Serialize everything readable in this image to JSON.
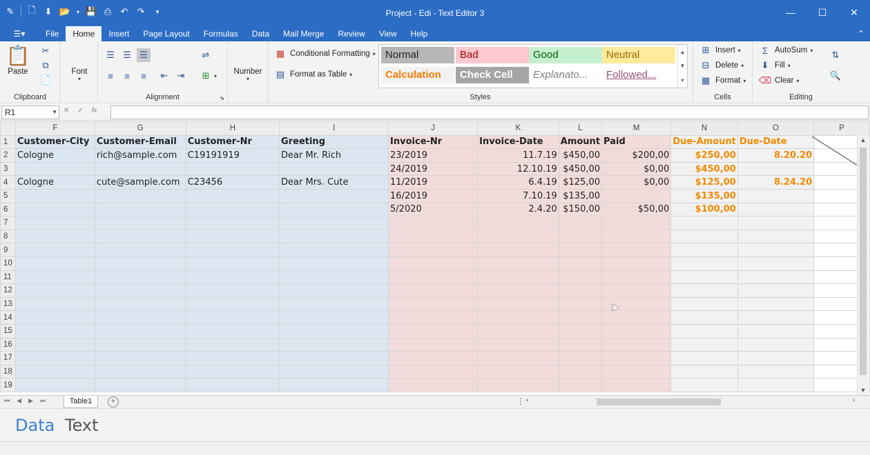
{
  "window": {
    "title": "Project - Edi - Text Editor 3"
  },
  "ribbon_tabs": [
    "File",
    "Home",
    "Insert",
    "Page Layout",
    "Formulas",
    "Data",
    "Mail Merge",
    "Review",
    "View",
    "Help"
  ],
  "ribbon": {
    "clipboard": {
      "paste": "Paste",
      "label": "Clipboard"
    },
    "font": {
      "button": "Font"
    },
    "alignment": {
      "label": "Alignment"
    },
    "number": {
      "button": "Number"
    },
    "conditional_formatting": "Conditional Formatting",
    "format_as_table": "Format as Table",
    "styles": {
      "label": "Styles",
      "items": [
        {
          "name": "Normal",
          "bg": "#b7b7b7",
          "fg": "#222222"
        },
        {
          "name": "Bad",
          "bg": "#ffc7ce",
          "fg": "#9c0006"
        },
        {
          "name": "Good",
          "bg": "#c6efce",
          "fg": "#006100"
        },
        {
          "name": "Neutral",
          "bg": "#ffeb9c",
          "fg": "#9c6500"
        },
        {
          "name": "Calculation",
          "bg": "#f2f2f2",
          "fg": "#fa7d00"
        },
        {
          "name": "Check Cell",
          "bg": "#a5a5a5",
          "fg": "#ffffff"
        },
        {
          "name": "Explanato...",
          "bg": "#ffffff",
          "fg": "#7f7f7f"
        },
        {
          "name": "Followed...",
          "bg": "#ffffff",
          "fg": "#954f72"
        }
      ]
    },
    "cells": {
      "insert": "Insert",
      "delete": "Delete",
      "format": "Format",
      "label": "Cells"
    },
    "editing": {
      "autosum": "AutoSum",
      "fill": "Fill",
      "clear": "Clear",
      "label": "Editing"
    }
  },
  "formula_bar": {
    "name_box": "R1",
    "formula": ""
  },
  "grid": {
    "columns": [
      "F",
      "G",
      "H",
      "I",
      "J",
      "K",
      "L",
      "M",
      "N",
      "O",
      "P"
    ],
    "rows": [
      [
        "Customer-City",
        "Customer-Email",
        "Customer-Nr",
        "Greeting",
        "Invoice-Nr",
        "Invoice-Date",
        "Amount",
        "Paid",
        "Due-Amount",
        "Due-Date",
        ""
      ],
      [
        "Cologne",
        "rich@sample.com",
        "C19191919",
        "Dear Mr. Rich",
        "23/2019",
        "11.7.19",
        "$450,00",
        "$200,00",
        "$250,00",
        "8.20.20",
        ""
      ],
      [
        "",
        "",
        "",
        "",
        "24/2019",
        "12.10.19",
        "$450,00",
        "$0,00",
        "$450,00",
        "",
        ""
      ],
      [
        "Cologne",
        "cute@sample.com",
        "C23456",
        "Dear Mrs. Cute",
        "11/2019",
        "6.4.19",
        "$125,00",
        "$0,00",
        "$125,00",
        "8.24.20",
        ""
      ],
      [
        "",
        "",
        "",
        "",
        "16/2019",
        "7.10.19",
        "$135,00",
        "",
        "$135,00",
        "",
        ""
      ],
      [
        "",
        "",
        "",
        "",
        "5/2020",
        "2.4.20",
        "$150,00",
        "$50,00",
        "$100,00",
        "",
        ""
      ],
      [
        "",
        "",
        "",
        "",
        "",
        "",
        "",
        "",
        "",
        "",
        ""
      ],
      [
        "",
        "",
        "",
        "",
        "",
        "",
        "",
        "",
        "",
        "",
        ""
      ],
      [
        "",
        "",
        "",
        "",
        "",
        "",
        "",
        "",
        "",
        "",
        ""
      ],
      [
        "",
        "",
        "",
        "",
        "",
        "",
        "",
        "",
        "",
        "",
        ""
      ],
      [
        "",
        "",
        "",
        "",
        "",
        "",
        "",
        "",
        "",
        "",
        ""
      ],
      [
        "",
        "",
        "",
        "",
        "",
        "",
        "",
        "",
        "",
        "",
        ""
      ],
      [
        "",
        "",
        "",
        "",
        "",
        "",
        "",
        "",
        "",
        "",
        ""
      ],
      [
        "",
        "",
        "",
        "",
        "",
        "",
        "",
        "",
        "",
        "",
        ""
      ],
      [
        "",
        "",
        "",
        "",
        "",
        "",
        "",
        "",
        "",
        "",
        ""
      ],
      [
        "",
        "",
        "",
        "",
        "",
        "",
        "",
        "",
        "",
        "",
        ""
      ],
      [
        "",
        "",
        "",
        "",
        "",
        "",
        "",
        "",
        "",
        "",
        ""
      ],
      [
        "",
        "",
        "",
        "",
        "",
        "",
        "",
        "",
        "",
        "",
        ""
      ],
      [
        "",
        "",
        "",
        "",
        "",
        "",
        "",
        "",
        "",
        "",
        ""
      ]
    ]
  },
  "sheet_tabs": [
    "Table1"
  ],
  "bottom_tabs": [
    "Data",
    "Text"
  ],
  "colors": {
    "accent": "#2b6cc4",
    "orange": "#f28a00",
    "blue_fill": "#dce6f1",
    "pink_fill": "#f2dcdb"
  }
}
